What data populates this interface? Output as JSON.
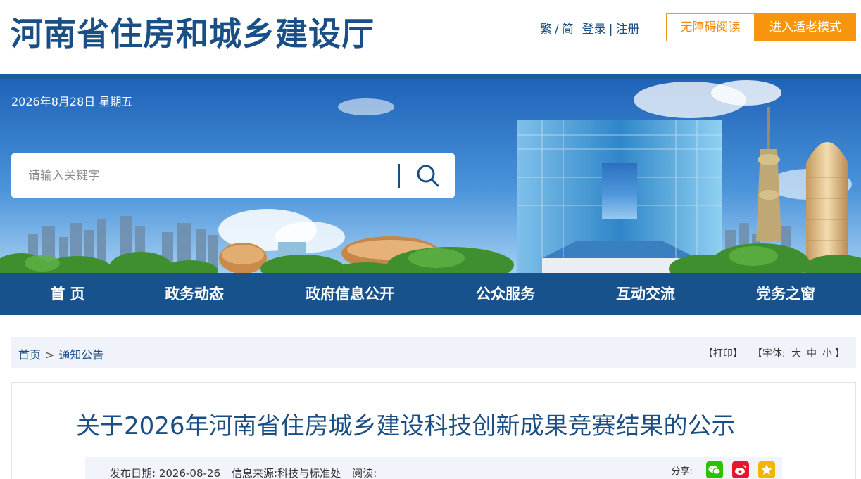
{
  "header": {
    "site_title": "河南省住房和城乡建设厅",
    "lang_trad": "繁",
    "lang_sep": "/",
    "lang_simp": "简",
    "login": "登录",
    "auth_sep": "|",
    "register": "注册",
    "accessibility_button": "无障碍阅读",
    "elderly_button": "进入适老模式"
  },
  "banner": {
    "date": "2026年8月28日 星期五",
    "search_placeholder": "请输入关键字"
  },
  "nav": {
    "items": [
      {
        "label": "首 页"
      },
      {
        "label": "政务动态"
      },
      {
        "label": "政府信息公开"
      },
      {
        "label": "公众服务"
      },
      {
        "label": "互动交流"
      },
      {
        "label": "党务之窗"
      }
    ]
  },
  "breadcrumb": {
    "home": "首页",
    "separator": ">",
    "current": "通知公告"
  },
  "tools": {
    "print": "【打印】",
    "font_label": "【字体:",
    "font_large": "大",
    "font_medium": "中",
    "font_small": "小",
    "font_end": "】"
  },
  "article": {
    "title": "关于2026年河南省住房城乡建设科技创新成果竞赛结果的公示",
    "publish_label": "发布日期:",
    "publish_date": "2026-08-26",
    "source_label": "信息来源:",
    "source": "科技与标准处",
    "reads_label": "阅读:",
    "share_label": "分享:"
  },
  "colors": {
    "brand_blue": "#1a4f86",
    "nav_blue": "#17528c",
    "accent_orange": "#f7950f",
    "wechat_green": "#2dc100",
    "weibo_red": "#e6162d",
    "favorite_yellow": "#f5b400"
  },
  "icons": {
    "search": "search-icon",
    "wechat": "wechat-icon",
    "weibo": "weibo-icon",
    "favorite": "star-icon"
  }
}
